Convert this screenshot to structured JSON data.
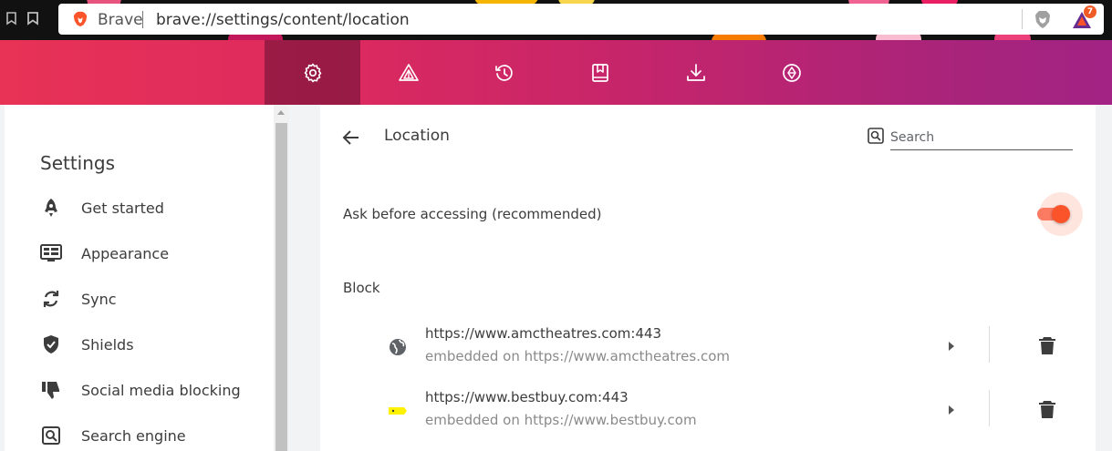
{
  "browser": {
    "brand": "Brave",
    "url": "brave://settings/content/location",
    "rewards_badge": "7"
  },
  "toolbar": {
    "buttons": [
      {
        "name": "settings",
        "icon": "gear-icon",
        "active": true
      },
      {
        "name": "rewards",
        "icon": "rewards-triangle-icon",
        "active": false
      },
      {
        "name": "history",
        "icon": "history-icon",
        "active": false
      },
      {
        "name": "bookmarks",
        "icon": "bookmark-icon",
        "active": false
      },
      {
        "name": "downloads",
        "icon": "download-icon",
        "active": false
      },
      {
        "name": "wallet",
        "icon": "wallet-icon",
        "active": false
      }
    ]
  },
  "sidebar": {
    "title": "Settings",
    "items": [
      {
        "label": "Get started",
        "icon": "rocket-icon"
      },
      {
        "label": "Appearance",
        "icon": "appearance-icon"
      },
      {
        "label": "Sync",
        "icon": "sync-icon"
      },
      {
        "label": "Shields",
        "icon": "shield-icon"
      },
      {
        "label": "Social media blocking",
        "icon": "thumbs-down-icon"
      },
      {
        "label": "Search engine",
        "icon": "search-engine-icon"
      }
    ]
  },
  "main": {
    "title": "Location",
    "search_placeholder": "Search",
    "ask_label": "Ask before accessing (recommended)",
    "ask_enabled": true,
    "block_heading": "Block",
    "blocked_sites": [
      {
        "url": "https://www.amctheatres.com:443",
        "embedded": "embedded on https://www.amctheatres.com",
        "icon": "globe-icon"
      },
      {
        "url": "https://www.bestbuy.com:443",
        "embedded": "embedded on https://www.bestbuy.com",
        "icon": "bestbuy-tag-icon"
      }
    ]
  },
  "colors": {
    "brand_orange": "#fb542b",
    "toolbar_gradient_start": "#e83256",
    "toolbar_gradient_end": "#a22384"
  }
}
